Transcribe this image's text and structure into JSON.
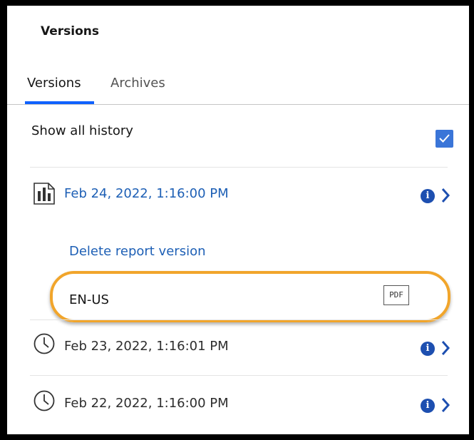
{
  "panel": {
    "title": "Versions"
  },
  "tabs": [
    {
      "label": "Versions",
      "active": true
    },
    {
      "label": "Archives",
      "active": false
    }
  ],
  "history": {
    "label": "Show all history",
    "checked": true
  },
  "versions": [
    {
      "date": "Feb 24, 2022, 1:16:00 PM",
      "icon": "report-icon",
      "expanded": true
    },
    {
      "date": "Feb 23, 2022, 1:16:01 PM",
      "icon": "clock-icon",
      "expanded": false
    },
    {
      "date": "Feb 22, 2022, 1:16:00 PM",
      "icon": "clock-icon",
      "expanded": false
    }
  ],
  "expanded_version": {
    "delete_label": "Delete report version",
    "outputs": [
      {
        "locale": "EN-US",
        "format": "PDF"
      }
    ]
  },
  "colors": {
    "link": "#1d5fb5",
    "accent": "#0f62fe",
    "highlight": "#f1a52b",
    "info": "#1d4fb0"
  }
}
